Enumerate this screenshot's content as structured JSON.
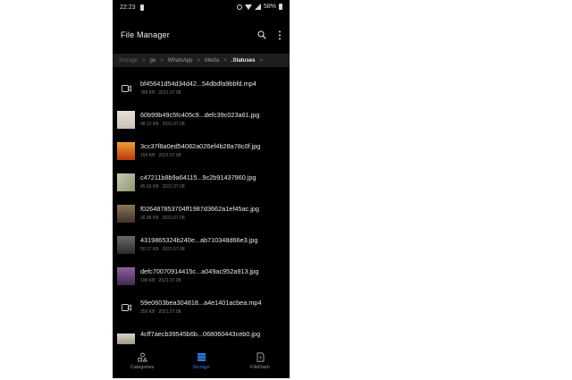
{
  "status_bar": {
    "time": "22:23",
    "battery_percent": "58%"
  },
  "header": {
    "title": "File Manager"
  },
  "breadcrumb": [
    {
      "label": "Storage",
      "state": "dim"
    },
    {
      "label": "ge",
      "state": "normal"
    },
    {
      "label": "WhatsApp",
      "state": "normal"
    },
    {
      "label": "Media",
      "state": "normal"
    },
    {
      "label": ".Statuses",
      "state": "active"
    }
  ],
  "files": [
    {
      "name": "bf45641d54d34d42...54dbdfa9bbfd.mp4",
      "size": "789 KB",
      "date": "2021.07.08",
      "kind": "video"
    },
    {
      "name": "60b99b49c5fc405c9...defc39c023a61.jpg",
      "size": "98.12 KB",
      "date": "2021.07.08",
      "kind": "image",
      "thumb_color": "#c9c2b6"
    },
    {
      "name": "3cc37f8a0ed54082a026ef4b28a78c0f.jpg",
      "size": "154 KB",
      "date": "2021.07.08",
      "kind": "image",
      "thumb_color": "#d0611a"
    },
    {
      "name": "c47211b8b9a64115...9c2b91437960.jpg",
      "size": "45.93 KB",
      "date": "2021.07.08",
      "kind": "image",
      "thumb_color": "#a8ad8e"
    },
    {
      "name": "f026487853704ff1987d3662a1ef45ac.jpg",
      "size": "26.88 KB",
      "date": "2021.07.08",
      "kind": "image",
      "thumb_color": "#6b5a44"
    },
    {
      "name": "4319865324b240e...ab710348d66e3.jpg",
      "size": "50.17 KB",
      "date": "2021.07.08",
      "kind": "image",
      "thumb_color": "#4a4a4a"
    },
    {
      "name": "defc70070914415c...a049ac952a913.jpg",
      "size": "199 KB",
      "date": "2021.07.08",
      "kind": "image",
      "thumb_color": "#6a4a7a"
    },
    {
      "name": "59e0603bea304818...a4e1401acbea.mp4",
      "size": "259 KB",
      "date": "2021.07.08",
      "kind": "video"
    },
    {
      "name": "4cff7aecb39545b6b...068060443ceb0.jpg",
      "size": "",
      "date": "",
      "kind": "image",
      "thumb_color": "#b8b4a8"
    }
  ],
  "bottom_nav": [
    {
      "label": "Categories",
      "icon": "categories-icon",
      "active": false
    },
    {
      "label": "Storage",
      "icon": "storage-icon",
      "active": true
    },
    {
      "label": "FileDash",
      "icon": "filedash-icon",
      "active": false
    }
  ],
  "colors": {
    "background": "#000000",
    "accent": "#2a7de1",
    "breadcrumb_bg": "#1e1e1e"
  }
}
